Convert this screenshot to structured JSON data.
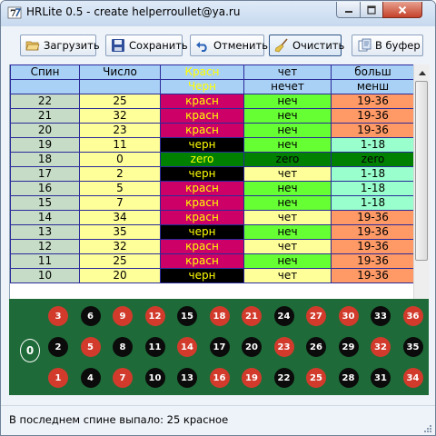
{
  "window": {
    "title": "HRLite 0.5 - create helperroullet@ya.ru"
  },
  "toolbar": [
    {
      "id": "load",
      "label": "Загрузить",
      "icon": "open-folder-icon"
    },
    {
      "id": "save",
      "label": "Сохранить",
      "icon": "floppy-disk-icon"
    },
    {
      "id": "undo",
      "label": "Отменить",
      "icon": "undo-arrow-icon"
    },
    {
      "id": "clear",
      "label": "Очистить",
      "icon": "broom-icon"
    },
    {
      "id": "copy",
      "label": "В буфер",
      "icon": "clipboard-icon"
    }
  ],
  "table": {
    "header_row1": [
      "Спин",
      "Число",
      "Красн",
      "чет",
      "больш"
    ],
    "header_row2": [
      "",
      "",
      "Черн",
      "нечет",
      "менш"
    ],
    "rows": [
      [
        "22",
        "25",
        "красн",
        "неч",
        "19-36"
      ],
      [
        "21",
        "32",
        "красн",
        "неч",
        "19-36"
      ],
      [
        "20",
        "23",
        "красн",
        "неч",
        "19-36"
      ],
      [
        "19",
        "11",
        "черн",
        "неч",
        "1-18"
      ],
      [
        "18",
        "0",
        "zero",
        "zero",
        "zero"
      ],
      [
        "17",
        "2",
        "черн",
        "чет",
        "1-18"
      ],
      [
        "16",
        "5",
        "красн",
        "неч",
        "1-18"
      ],
      [
        "15",
        "7",
        "красн",
        "неч",
        "1-18"
      ],
      [
        "14",
        "34",
        "красн",
        "чет",
        "19-36"
      ],
      [
        "13",
        "35",
        "черн",
        "неч",
        "19-36"
      ],
      [
        "12",
        "32",
        "красн",
        "чет",
        "19-36"
      ],
      [
        "11",
        "25",
        "красн",
        "неч",
        "19-36"
      ],
      [
        "10",
        "20",
        "черн",
        "чет",
        "19-36"
      ]
    ]
  },
  "board": {
    "zero_label": "0",
    "rows": [
      [
        {
          "n": "3",
          "c": "r"
        },
        {
          "n": "6",
          "c": "b"
        },
        {
          "n": "9",
          "c": "r"
        },
        {
          "n": "12",
          "c": "r"
        },
        {
          "n": "15",
          "c": "b"
        },
        {
          "n": "18",
          "c": "r"
        },
        {
          "n": "21",
          "c": "r"
        },
        {
          "n": "24",
          "c": "b"
        },
        {
          "n": "27",
          "c": "r"
        },
        {
          "n": "30",
          "c": "r"
        },
        {
          "n": "33",
          "c": "b"
        },
        {
          "n": "36",
          "c": "r"
        }
      ],
      [
        {
          "n": "2",
          "c": "b"
        },
        {
          "n": "5",
          "c": "r"
        },
        {
          "n": "8",
          "c": "b"
        },
        {
          "n": "11",
          "c": "b"
        },
        {
          "n": "14",
          "c": "r"
        },
        {
          "n": "17",
          "c": "b"
        },
        {
          "n": "20",
          "c": "b"
        },
        {
          "n": "23",
          "c": "r"
        },
        {
          "n": "26",
          "c": "b"
        },
        {
          "n": "29",
          "c": "b"
        },
        {
          "n": "32",
          "c": "r"
        },
        {
          "n": "35",
          "c": "b"
        }
      ],
      [
        {
          "n": "1",
          "c": "r"
        },
        {
          "n": "4",
          "c": "b"
        },
        {
          "n": "7",
          "c": "r"
        },
        {
          "n": "10",
          "c": "b"
        },
        {
          "n": "13",
          "c": "b"
        },
        {
          "n": "16",
          "c": "r"
        },
        {
          "n": "19",
          "c": "r"
        },
        {
          "n": "22",
          "c": "b"
        },
        {
          "n": "25",
          "c": "r"
        },
        {
          "n": "28",
          "c": "b"
        },
        {
          "n": "31",
          "c": "b"
        },
        {
          "n": "34",
          "c": "r"
        }
      ]
    ]
  },
  "status": {
    "text": "В последнем спине выпало: 25 красное"
  },
  "colors": {
    "spin_cell": "#c6dcc6",
    "number_cell": "#ffff99",
    "red_cell": "#cc0066",
    "black_cell": "#000000",
    "zero_cell": "#008000",
    "odd_cell": "#66ff33",
    "even_cell": "#ffff99",
    "high_cell": "#ff9966",
    "low_cell": "#99ffcc",
    "board_red": "#d23b2c",
    "board_black": "#0b0b0b",
    "felt": "#1e6a38"
  }
}
